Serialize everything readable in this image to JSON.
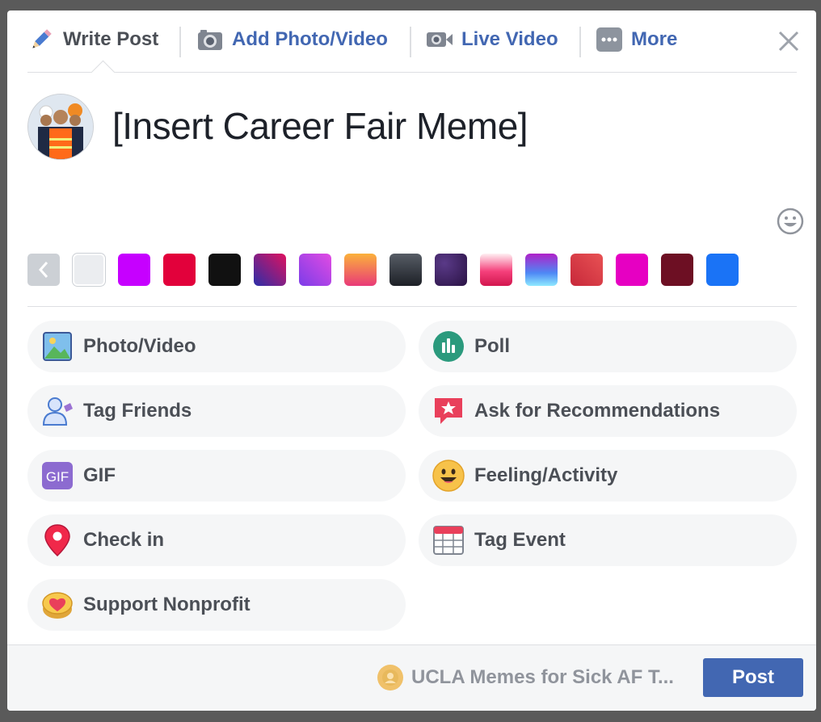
{
  "tabs": [
    {
      "label": "Write Post",
      "icon": "pencil-icon"
    },
    {
      "label": "Add Photo/Video",
      "icon": "camera-icon"
    },
    {
      "label": "Live Video",
      "icon": "video-camera-icon"
    },
    {
      "label": "More",
      "icon": "more-icon"
    }
  ],
  "composer": {
    "text": "[Insert Career Fair Meme]"
  },
  "background_colors": [
    {
      "name": "none",
      "color": "#ebedf0"
    },
    {
      "name": "purple",
      "color": "#c600ff"
    },
    {
      "name": "red",
      "color": "#e2013b"
    },
    {
      "name": "black",
      "color": "#111111"
    },
    {
      "name": "purple-red-gradient",
      "color": "#8e1a7f"
    },
    {
      "name": "violet-gradient",
      "color": "#a443e6"
    },
    {
      "name": "orange-gradient",
      "color": "#f68d3c"
    },
    {
      "name": "dark-gray-gradient",
      "color": "#3f4347"
    },
    {
      "name": "starry",
      "color": "#3b1e58"
    },
    {
      "name": "pink-gradient",
      "color": "#f5407b"
    },
    {
      "name": "blue-purple-gradient",
      "color": "#6a73e8"
    },
    {
      "name": "red-gradient",
      "color": "#d8373a"
    },
    {
      "name": "magenta",
      "color": "#e600c2"
    },
    {
      "name": "maroon",
      "color": "#6d0f23"
    },
    {
      "name": "blue",
      "color": "#1a73f6"
    }
  ],
  "actions": [
    {
      "label": "Photo/Video",
      "icon": "photo-icon"
    },
    {
      "label": "Poll",
      "icon": "poll-icon"
    },
    {
      "label": "Tag Friends",
      "icon": "tag-friends-icon"
    },
    {
      "label": "Ask for Recommendations",
      "icon": "recommendation-icon"
    },
    {
      "label": "GIF",
      "icon": "gif-icon"
    },
    {
      "label": "Feeling/Activity",
      "icon": "smiley-icon"
    },
    {
      "label": "Check in",
      "icon": "location-pin-icon"
    },
    {
      "label": "Tag Event",
      "icon": "calendar-icon"
    },
    {
      "label": "Support Nonprofit",
      "icon": "heart-coin-icon"
    }
  ],
  "footer": {
    "group_name": "UCLA Memes for Sick AF T...",
    "post_label": "Post"
  },
  "colors": {
    "accent": "#4267b2",
    "text": "#4b4f56",
    "muted": "#90949c"
  }
}
